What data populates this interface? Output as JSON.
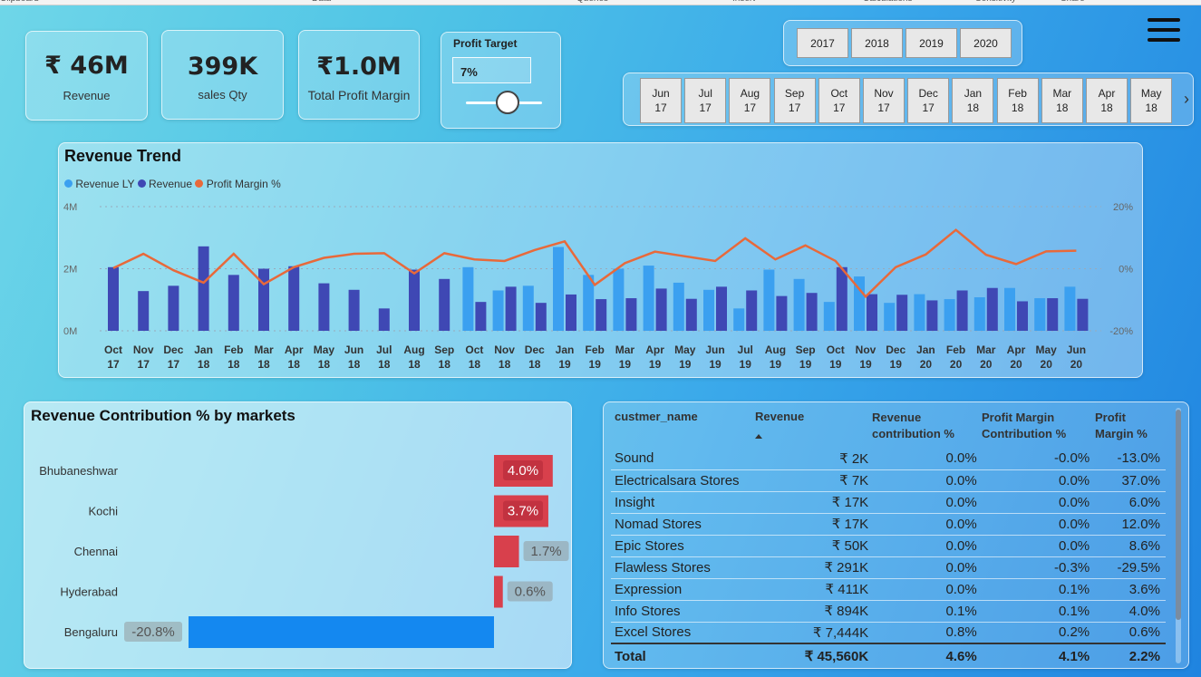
{
  "ribbon": [
    "Clipboard",
    "Data",
    "Queries",
    "Insert",
    "Calculations",
    "Sensitivity",
    "Share"
  ],
  "kpis": [
    {
      "value": "₹ 46M",
      "label": "Revenue"
    },
    {
      "value": "399K",
      "label": "sales Qty"
    },
    {
      "value": "₹1.0M",
      "label": "Total Profit Margin"
    }
  ],
  "profit_target": {
    "title": "Profit Target",
    "value": "7%",
    "slider_fraction": 0.55
  },
  "years": [
    "2017",
    "2018",
    "2019",
    "2020"
  ],
  "months": [
    {
      "m": "Jun",
      "y": "17"
    },
    {
      "m": "Jul",
      "y": "17"
    },
    {
      "m": "Aug",
      "y": "17"
    },
    {
      "m": "Sep",
      "y": "17"
    },
    {
      "m": "Oct",
      "y": "17"
    },
    {
      "m": "Nov",
      "y": "17"
    },
    {
      "m": "Dec",
      "y": "17"
    },
    {
      "m": "Jan",
      "y": "18"
    },
    {
      "m": "Feb",
      "y": "18"
    },
    {
      "m": "Mar",
      "y": "18"
    },
    {
      "m": "Apr",
      "y": "18"
    },
    {
      "m": "May",
      "y": "18"
    }
  ],
  "chart_data": [
    {
      "type": "bar",
      "title": "Revenue Trend",
      "legend": [
        "Revenue LY",
        "Revenue",
        "Profit Margin %"
      ],
      "legend_placement": "top-left",
      "colors": {
        "revenue_ly": "#3ba0f0",
        "revenue": "#3f48b4",
        "profit_margin": "#e8693a"
      },
      "yticks_left": [
        "4M",
        "2M",
        "0M"
      ],
      "yticks_right": [
        "20%",
        "0%",
        "-20%"
      ],
      "ylim": [
        0,
        4
      ],
      "ylim_right": [
        -20,
        20
      ],
      "categories": [
        [
          "Oct",
          "17"
        ],
        [
          "Nov",
          "17"
        ],
        [
          "Dec",
          "17"
        ],
        [
          "Jan",
          "18"
        ],
        [
          "Feb",
          "18"
        ],
        [
          "Mar",
          "18"
        ],
        [
          "Apr",
          "18"
        ],
        [
          "May",
          "18"
        ],
        [
          "Jun",
          "18"
        ],
        [
          "Jul",
          "18"
        ],
        [
          "Aug",
          "18"
        ],
        [
          "Sep",
          "18"
        ],
        [
          "Oct",
          "18"
        ],
        [
          "Nov",
          "18"
        ],
        [
          "Dec",
          "18"
        ],
        [
          "Jan",
          "19"
        ],
        [
          "Feb",
          "19"
        ],
        [
          "Mar",
          "19"
        ],
        [
          "Apr",
          "19"
        ],
        [
          "May",
          "19"
        ],
        [
          "Jun",
          "19"
        ],
        [
          "Jul",
          "19"
        ],
        [
          "Aug",
          "19"
        ],
        [
          "Sep",
          "19"
        ],
        [
          "Oct",
          "19"
        ],
        [
          "Nov",
          "19"
        ],
        [
          "Dec",
          "19"
        ],
        [
          "Jan",
          "20"
        ],
        [
          "Feb",
          "20"
        ],
        [
          "Mar",
          "20"
        ],
        [
          "Apr",
          "20"
        ],
        [
          "May",
          "20"
        ],
        [
          "Jun",
          "20"
        ]
      ],
      "series": [
        {
          "name": "Revenue LY",
          "values": [
            null,
            null,
            null,
            null,
            null,
            null,
            null,
            null,
            null,
            null,
            null,
            null,
            2.05,
            1.3,
            1.45,
            2.7,
            1.8,
            2.0,
            2.1,
            1.55,
            1.32,
            0.72,
            1.97,
            1.67,
            0.93,
            1.75,
            0.9,
            1.18,
            1.02,
            1.08,
            1.38,
            1.05,
            1.42
          ]
        },
        {
          "name": "Revenue",
          "values": [
            2.05,
            1.28,
            1.45,
            2.72,
            1.8,
            2.0,
            2.08,
            1.53,
            1.32,
            0.72,
            1.97,
            1.67,
            0.93,
            1.42,
            0.9,
            1.17,
            1.02,
            1.05,
            1.36,
            1.03,
            1.42,
            1.3,
            1.12,
            1.22,
            2.05,
            1.18,
            1.16,
            0.98,
            1.3,
            1.38,
            0.95,
            1.05,
            1.03
          ]
        },
        {
          "name": "Profit Margin %",
          "values": [
            0.2,
            4.8,
            -0.5,
            -4.5,
            4.8,
            -5.0,
            0.5,
            3.5,
            4.8,
            5.0,
            -1.5,
            5.0,
            3.0,
            2.5,
            6.0,
            8.8,
            -5.2,
            1.8,
            5.5,
            4.0,
            2.5,
            9.8,
            3.0,
            7.5,
            2.5,
            -9.0,
            0.5,
            4.6,
            12.5,
            4.5,
            1.5,
            5.6,
            5.8
          ]
        }
      ]
    },
    {
      "type": "bar",
      "title": "Revenue Contribution % by markets",
      "categories": [
        "Bhubaneshwar",
        "Kochi",
        "Chennai",
        "Hyderabad",
        "Bengaluru"
      ],
      "values": [
        4.0,
        3.7,
        1.7,
        0.6,
        -20.8
      ],
      "labels": [
        "4.0%",
        "3.7%",
        "1.7%",
        "0.6%",
        "-20.8%"
      ],
      "colors": {
        "positive": "#d8404c",
        "negative": "#1488f0"
      }
    }
  ],
  "table": {
    "headers": [
      "custmer_name",
      "Revenue",
      "Revenue contribution %",
      "Profit Margin Contribution %",
      "Profit Margin %"
    ],
    "rows": [
      [
        "Sound",
        "₹ 2K",
        "0.0%",
        "-0.0%",
        "-13.0%"
      ],
      [
        "Electricalsara Stores",
        "₹ 7K",
        "0.0%",
        "0.0%",
        "37.0%"
      ],
      [
        "Insight",
        "₹ 17K",
        "0.0%",
        "0.0%",
        "6.0%"
      ],
      [
        "Nomad Stores",
        "₹ 17K",
        "0.0%",
        "0.0%",
        "12.0%"
      ],
      [
        "Epic Stores",
        "₹ 50K",
        "0.0%",
        "0.0%",
        "8.6%"
      ],
      [
        "Flawless Stores",
        "₹ 291K",
        "0.0%",
        "-0.3%",
        "-29.5%"
      ],
      [
        "Expression",
        "₹ 411K",
        "0.0%",
        "0.1%",
        "3.6%"
      ],
      [
        "Info Stores",
        "₹ 894K",
        "0.1%",
        "0.1%",
        "4.0%"
      ],
      [
        "Excel Stores",
        "₹ 7,444K",
        "0.8%",
        "0.2%",
        "0.6%"
      ]
    ],
    "total": [
      "Total",
      "₹ 45,560K",
      "4.6%",
      "4.1%",
      "2.2%"
    ]
  }
}
